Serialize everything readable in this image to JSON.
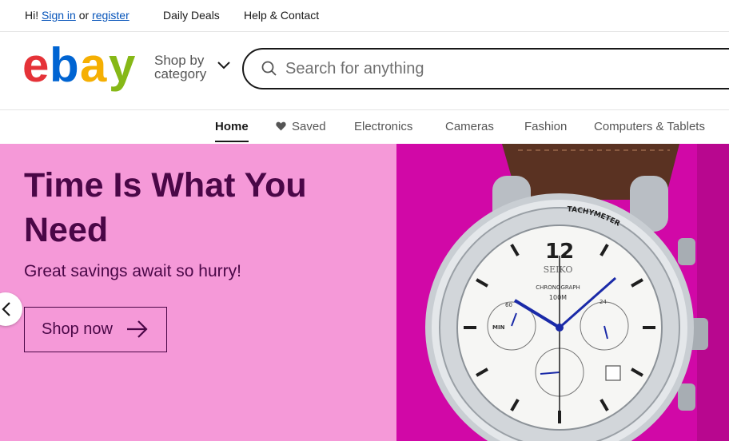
{
  "topbar": {
    "greeting": "Hi!",
    "sign_in": "Sign in",
    "or": "or",
    "register": "register",
    "links": [
      "Daily Deals",
      "Help & Contact"
    ]
  },
  "header": {
    "logo_letters": [
      "e",
      "b",
      "a",
      "y"
    ],
    "logo_colors": [
      "#e53238",
      "#0064d2",
      "#f5af02",
      "#86b817"
    ],
    "shop_by_category": "Shop by category",
    "search_placeholder": "Search for anything"
  },
  "nav": {
    "items": [
      "Home",
      "Saved",
      "Electronics",
      "Cameras",
      "Fashion",
      "Computers & Tablets"
    ],
    "active": "Home"
  },
  "hero": {
    "title": "Time Is What You Need",
    "subtitle": "Great savings await so hurry!",
    "cta": "Shop now",
    "colors": {
      "left_bg": "#f599d8",
      "right_bg": "#d108a7",
      "text": "#4a0747"
    },
    "watch": {
      "brand": "SEIKO",
      "label1": "CHRONOGRAPH",
      "label2": "100M",
      "bezel_text": "TACHYMETER",
      "twelve": "12",
      "min_label": "MIN",
      "subdial_24": "24",
      "subdial_60": "60"
    }
  },
  "colors": {
    "link": "#0654ba",
    "accent": "#191919"
  }
}
